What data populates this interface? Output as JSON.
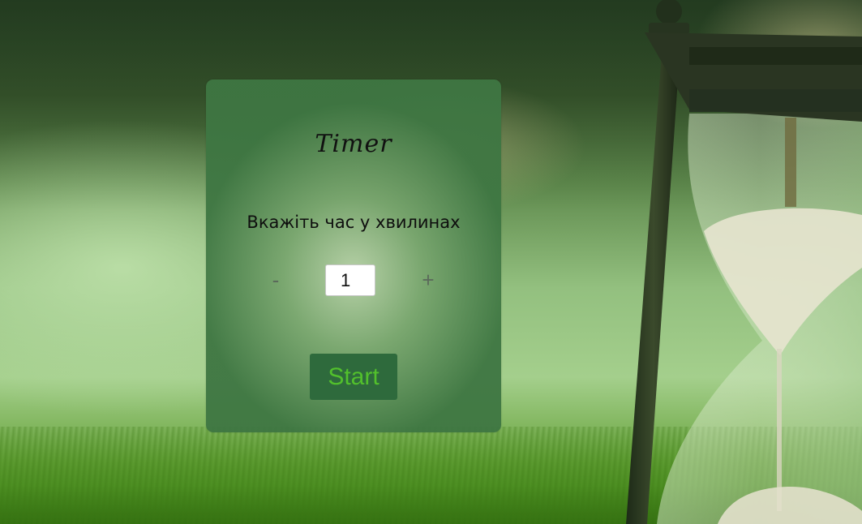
{
  "timer": {
    "title": "Timer",
    "prompt": "Вкажіть час у хвилинах",
    "decrement_label": "-",
    "increment_label": "+",
    "minutes_value": "1",
    "start_label": "Start"
  },
  "colors": {
    "panel_edge": "#3e7642",
    "start_background": "#2e6a3c",
    "start_text": "#52c02c"
  },
  "icons": {
    "background": "hourglass-illustration"
  }
}
